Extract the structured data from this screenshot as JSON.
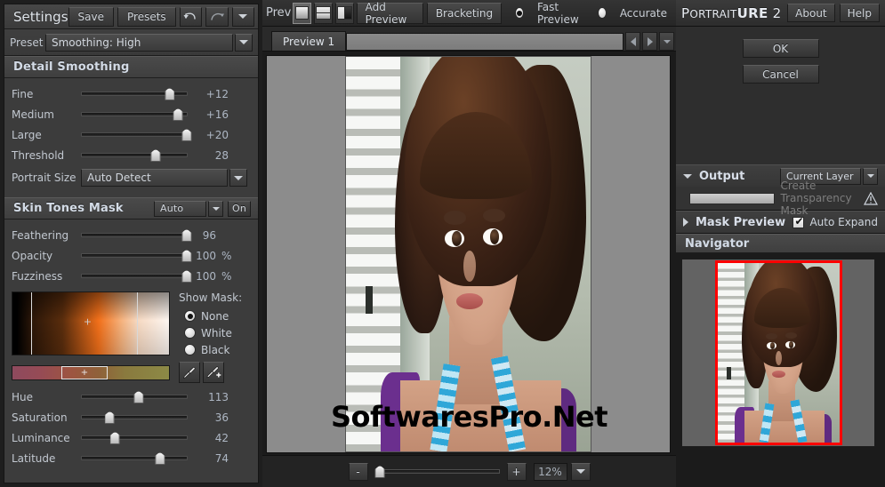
{
  "settings": {
    "title": "Settings",
    "save_label": "Save",
    "presets_label": "Presets",
    "undo_icon": "undo-icon",
    "redo_icon": "redo-icon",
    "menu_icon": "chevron-down-icon",
    "preset_label": "Preset",
    "preset_value": "Smoothing: High"
  },
  "detail_smoothing": {
    "header": "Detail Smoothing",
    "sliders": [
      {
        "label": "Fine",
        "value": "+12",
        "pct": 83
      },
      {
        "label": "Medium",
        "value": "+16",
        "pct": 91
      },
      {
        "label": "Large",
        "value": "+20",
        "pct": 99
      },
      {
        "label": "Threshold",
        "value": "28",
        "pct": 70
      }
    ],
    "portrait_size_label": "Portrait Size",
    "portrait_size_value": "Auto Detect"
  },
  "skin_tones_mask": {
    "header": "Skin Tones Mask",
    "mode_value": "Auto",
    "toggle_label": "On",
    "sliders": [
      {
        "label": "Feathering",
        "value": "96",
        "unit": "",
        "pct": 99
      },
      {
        "label": "Opacity",
        "value": "100",
        "unit": "%",
        "pct": 99
      },
      {
        "label": "Fuzziness",
        "value": "100",
        "unit": "%",
        "pct": 99
      }
    ],
    "show_mask_label": "Show Mask:",
    "show_mask_options": [
      {
        "label": "None",
        "selected": true
      },
      {
        "label": "White",
        "selected": false
      },
      {
        "label": "Black",
        "selected": false
      }
    ],
    "picker_marker": "+",
    "strip_marker": "+",
    "eyedropper_icon": "eyedropper-icon",
    "eyedropper_add_icon": "eyedropper-add-icon",
    "hsl_sliders": [
      {
        "label": "Hue",
        "value": "113",
        "pct": 54
      },
      {
        "label": "Saturation",
        "value": "36",
        "pct": 27
      },
      {
        "label": "Luminance",
        "value": "42",
        "pct": 32
      },
      {
        "label": "Latitude",
        "value": "74",
        "pct": 74
      }
    ]
  },
  "preview_toolbar": {
    "prev_label": "Prev",
    "view_single_icon": "single-pane-icon",
    "view_split_h_icon": "split-horizontal-icon",
    "view_split_v_icon": "split-vertical-icon",
    "add_preview_label": "Add Preview",
    "bracketing_label": "Bracketing",
    "quality_options": [
      {
        "label": "Fast Preview",
        "selected": true
      },
      {
        "label": "Accurate",
        "selected": false
      }
    ]
  },
  "preview_tabs": {
    "tabs": [
      "Preview 1"
    ],
    "prev_icon": "arrow-left-icon",
    "next_icon": "arrow-right-icon",
    "menu_icon": "chevron-down-icon"
  },
  "zoom_bar": {
    "minus_label": "-",
    "plus_label": "+",
    "zoom_value": "12%",
    "menu_icon": "chevron-down-icon",
    "slider_pct": 4
  },
  "watermark": "SoftwaresPro.Net",
  "right_panel": {
    "brand_p": "P",
    "brand_small": "ORTRAIT",
    "brand_bold": "URE",
    "brand_num": "2",
    "about_label": "About",
    "help_label": "Help",
    "ok_label": "OK",
    "cancel_label": "Cancel",
    "output": {
      "header": "Output",
      "expand_icon": "triangle-down-icon",
      "target_value": "Current Layer",
      "transparency_label": "Create Transparency Mask",
      "transparency_checked": false,
      "warning_icon": "warning-triangle-icon"
    },
    "mask_preview": {
      "header": "Mask Preview",
      "collapse_icon": "triangle-right-icon",
      "auto_expand_label": "Auto Expand",
      "auto_expand_checked": true
    },
    "navigator": {
      "header": "Navigator",
      "selection_color": "#ff0000"
    }
  },
  "colors": {
    "panel_bg": "#3c3c3c",
    "window_bg": "#1b1b1b",
    "text": "#c8cdd4",
    "accent_red": "#ff0000",
    "canvas_bg": "#8c8c8c"
  }
}
